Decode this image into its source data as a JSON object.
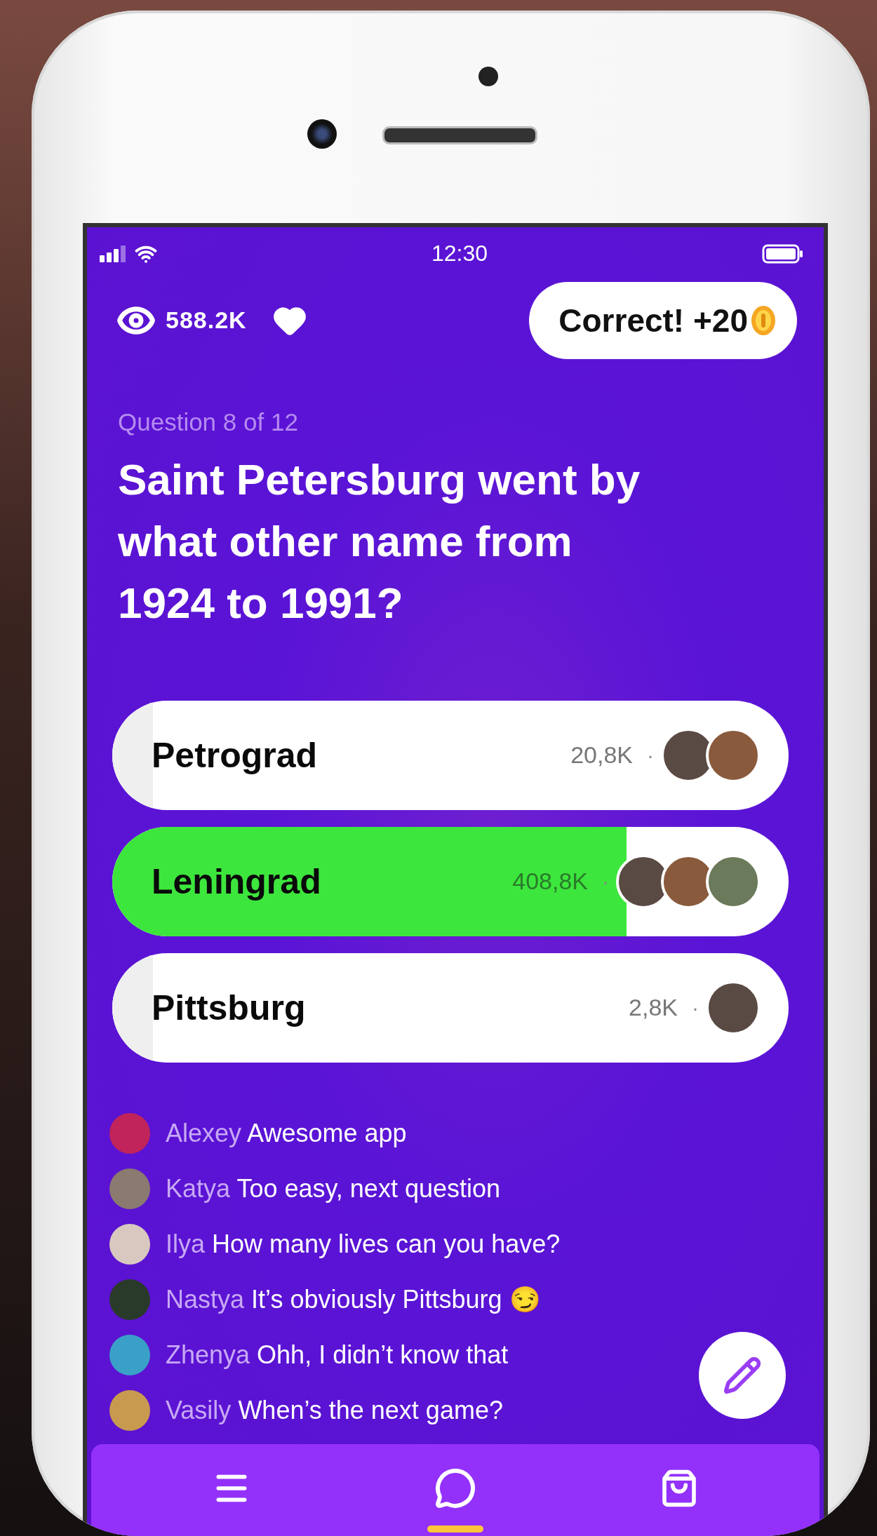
{
  "status_bar": {
    "time": "12:30"
  },
  "header": {
    "views": "588.2K",
    "badge": "Correct! +20"
  },
  "question": {
    "counter": "Question 8 of 12",
    "text": "Saint Petersburg went by what other name from 1924 to 1991?"
  },
  "answers": [
    {
      "label": "Petrograd",
      "count": "20,8K",
      "separator": "·",
      "correct": false,
      "level": 0.06,
      "avatars": [
        {
          "kind": "photo"
        },
        {
          "kind": "photo"
        }
      ]
    },
    {
      "label": "Leningrad",
      "count": "408,8K",
      "separator": "·",
      "correct": true,
      "level": 0.76,
      "avatars": [
        {
          "kind": "photo"
        },
        {
          "kind": "photo"
        },
        {
          "kind": "photo"
        }
      ]
    },
    {
      "label": "Pittsburg",
      "count": "2,8K",
      "separator": "·",
      "correct": false,
      "level": 0.06,
      "avatars": [
        {
          "kind": "photo"
        }
      ]
    }
  ],
  "chat": [
    {
      "name": "Alexey",
      "message": "Awesome app",
      "color": "#c0245a"
    },
    {
      "name": "Katya",
      "message": "Too easy, next question",
      "color": "#8a7a70"
    },
    {
      "name": "Ilya",
      "message": "How many lives can you have?",
      "color": "#d8c8c0"
    },
    {
      "name": "Nastya",
      "message": "It’s obviously Pittsburg 😏",
      "color": "#2a3a2a"
    },
    {
      "name": "Zhenya",
      "message": "Ohh, I didn’t know that",
      "color": "#3aa0c8"
    },
    {
      "name": "Vasily",
      "message": "When’s the next game?",
      "color": "#c89a50"
    }
  ],
  "nav": [
    {
      "kind": "menu",
      "selected": false
    },
    {
      "kind": "chat",
      "selected": true
    },
    {
      "kind": "bag",
      "selected": false
    }
  ]
}
